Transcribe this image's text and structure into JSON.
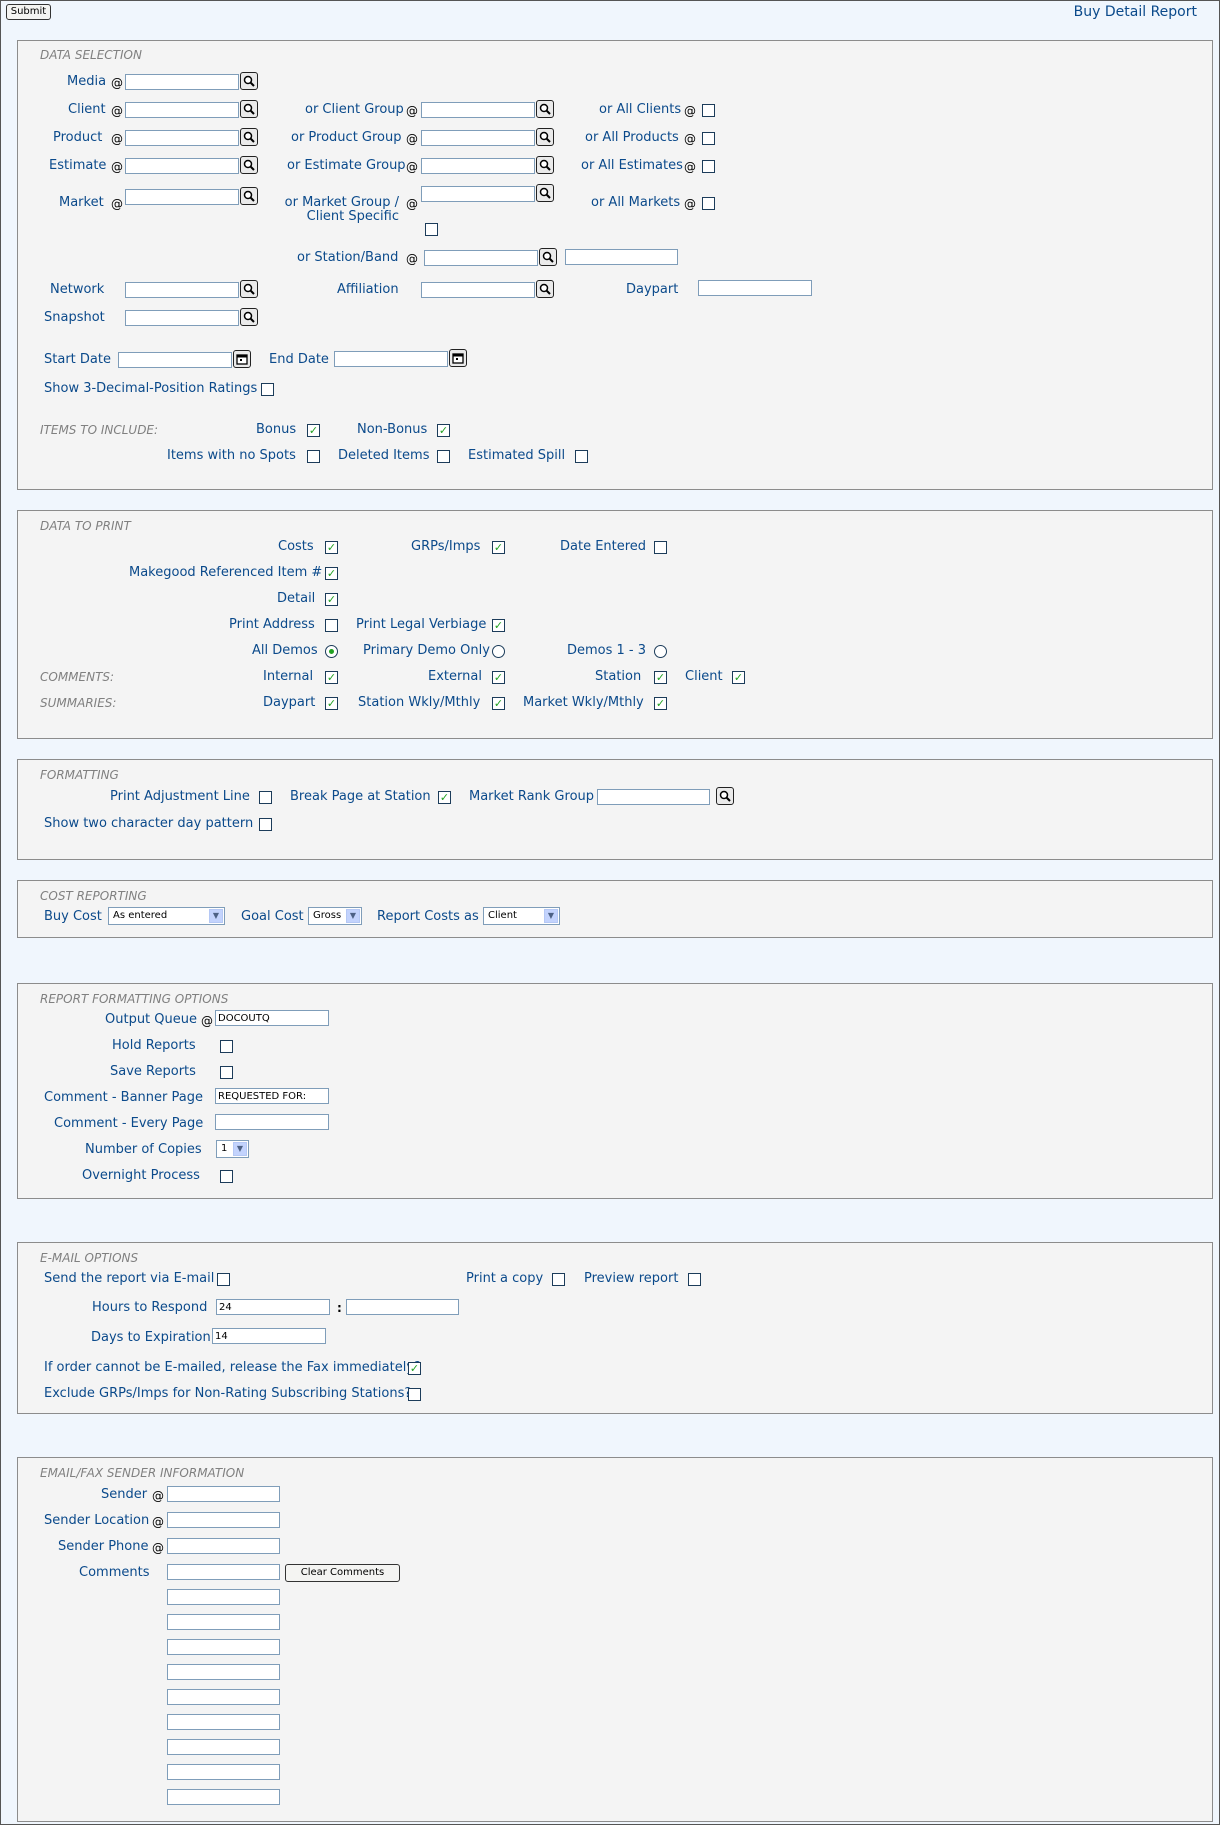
{
  "header": {
    "submit_label": "Submit",
    "report_title": "Buy Detail Report"
  },
  "at_symbol": "@",
  "colon": ":",
  "data_selection": {
    "legend": "DATA SELECTION",
    "media": "Media",
    "client": "Client",
    "client_group": "or Client Group",
    "all_clients": "or All Clients",
    "product": "Product",
    "product_group": "or Product Group",
    "all_products": "or All Products",
    "estimate": "Estimate",
    "estimate_group": "or Estimate Group",
    "all_estimates": "or All Estimates",
    "market": "Market",
    "market_group_line1": "or Market Group /",
    "market_group_line2": "Client Specific",
    "all_markets": "or All Markets",
    "station_band": "or Station/Band",
    "network": "Network",
    "affiliation": "Affiliation",
    "daypart": "Daypart",
    "snapshot": "Snapshot",
    "start_date": "Start Date",
    "end_date": "End Date",
    "show_3dec": "Show 3-Decimal-Position Ratings"
  },
  "items_to_include": {
    "legend": "ITEMS TO INCLUDE:",
    "bonus": "Bonus",
    "non_bonus": "Non-Bonus",
    "no_spots": "Items with no Spots",
    "deleted": "Deleted Items",
    "spill": "Estimated Spill"
  },
  "data_to_print": {
    "legend": "DATA TO PRINT",
    "costs": "Costs",
    "grps": "GRPs/Imps",
    "date_entered": "Date Entered",
    "makegood": "Makegood Referenced Item #",
    "detail": "Detail",
    "print_address": "Print Address",
    "print_legal": "Print Legal Verbiage",
    "all_demos": "All Demos",
    "primary_demo": "Primary Demo Only",
    "demos_1_3": "Demos 1 - 3",
    "comments_label": "COMMENTS:",
    "internal": "Internal",
    "external": "External",
    "station": "Station",
    "client": "Client",
    "summaries_label": "SUMMARIES:",
    "daypart": "Daypart",
    "station_wkly": "Station Wkly/Mthly",
    "market_wkly": "Market Wkly/Mthly"
  },
  "formatting": {
    "legend": "FORMATTING",
    "print_adj": "Print Adjustment Line",
    "break_page": "Break Page at Station",
    "market_rank": "Market Rank Group",
    "two_char_day": "Show two character day pattern"
  },
  "cost_reporting": {
    "legend": "COST REPORTING",
    "buy_cost": "Buy Cost",
    "buy_cost_value": "As entered",
    "goal_cost": "Goal Cost",
    "goal_cost_value": "Gross",
    "report_costs_as": "Report Costs as",
    "report_costs_value": "Client"
  },
  "report_formatting": {
    "legend": "REPORT FORMATTING OPTIONS",
    "output_queue": "Output Queue",
    "output_queue_value": "DOCOUTQ",
    "hold_reports": "Hold Reports",
    "save_reports": "Save Reports",
    "comment_banner": "Comment - Banner Page",
    "comment_banner_value": "REQUESTED FOR:",
    "comment_every": "Comment - Every Page",
    "copies": "Number of Copies",
    "copies_value": "1",
    "overnight": "Overnight Process"
  },
  "email_options": {
    "legend": "E-MAIL OPTIONS",
    "send_email": "Send the report via E-mail",
    "print_copy": "Print a copy",
    "preview": "Preview report",
    "hours": "Hours to Respond",
    "hours_value": "24",
    "days": "Days to Expiration",
    "days_value": "14",
    "release_fax": "If order cannot be E-mailed, release the Fax immediately?",
    "exclude_grps": "Exclude GRPs/Imps for Non-Rating Subscribing Stations?"
  },
  "sender_info": {
    "legend": "EMAIL/FAX SENDER INFORMATION",
    "sender": "Sender",
    "sender_location": "Sender Location",
    "sender_phone": "Sender Phone",
    "comments": "Comments",
    "clear_comments": "Clear Comments"
  },
  "colors": {
    "label": "#0b4a8b",
    "check": "#21a121",
    "legend": "#808080"
  }
}
